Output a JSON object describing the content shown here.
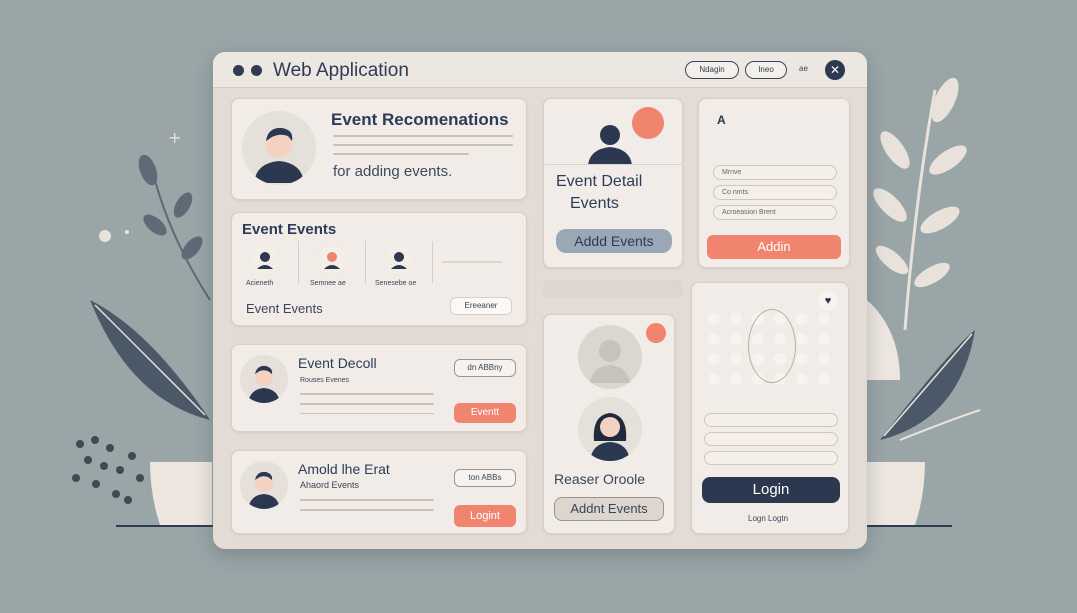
{
  "window": {
    "title": "Web Application"
  },
  "header": {
    "pill1": "Ndagin",
    "pill2": "Ineo",
    "extra": "ae"
  },
  "recommendations": {
    "title": "Event Recomenations",
    "subtitle": "for adding events."
  },
  "events_panel": {
    "title": "Event Events",
    "users": [
      "Acieneth",
      "Semnee ae",
      "Senesebe oe"
    ],
    "footer": "Event Events",
    "button": "Ereeaner"
  },
  "row1": {
    "title": "Event Decoll",
    "sub": "Rouses Evenes",
    "pill": "dn ABBny",
    "button": "Eventt"
  },
  "row2": {
    "title": "Amold lhe Erat",
    "sub": "Ahaord Events",
    "pill": "ton ABBs",
    "button": "Logint"
  },
  "detail": {
    "title_line1": "Event Detail",
    "title_line2": "Events",
    "button": "Addd Events"
  },
  "reaser": {
    "title": "Reaser Oroole",
    "button": "Addnt Events"
  },
  "login_form": {
    "mark": "A",
    "field1": "Mrnve",
    "field2": "Co nmts",
    "field3": "Acroeasion       Brent",
    "button": "Addin"
  },
  "login_panel": {
    "button": "Login",
    "link": "Logn Logtn"
  },
  "colors": {
    "accent": "#f1846f",
    "navy": "#2b3850",
    "window_bg": "#e3dcd4",
    "card_bg": "#f1ece7",
    "page_bg": "#9aa5a8"
  }
}
